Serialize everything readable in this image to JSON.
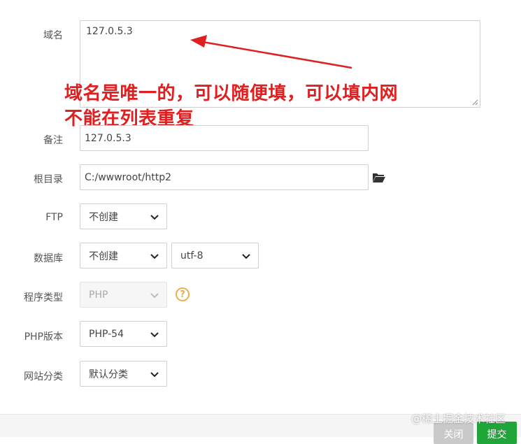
{
  "form": {
    "domain": {
      "label": "域名",
      "value": "127.0.5.3"
    },
    "remark": {
      "label": "备注",
      "value": "127.0.5.3"
    },
    "root_dir": {
      "label": "根目录",
      "value": "C:/wwwroot/http2"
    },
    "ftp": {
      "label": "FTP",
      "selected": "不创建"
    },
    "database": {
      "label": "数据库",
      "selected": "不创建",
      "charset": "utf-8"
    },
    "program_type": {
      "label": "程序类型",
      "selected": "PHP",
      "help": "?"
    },
    "php_version": {
      "label": "PHP版本",
      "selected": "PHP-54"
    },
    "site_category": {
      "label": "网站分类",
      "selected": "默认分类"
    }
  },
  "annotation": {
    "line1": "域名是唯一的，可以随便填，可以填内网",
    "line2": "不能在列表重复",
    "color": "#e02020"
  },
  "footer": {
    "close_label": "关闭",
    "submit_label": "提交",
    "close_color": "#c9c9c9",
    "submit_color": "#20a53a"
  },
  "watermark": "@稀土掘金技术社区",
  "icons": {
    "folder": "folder-open-icon",
    "help": "question-circle-icon",
    "chevron": "chevron-down-icon"
  }
}
